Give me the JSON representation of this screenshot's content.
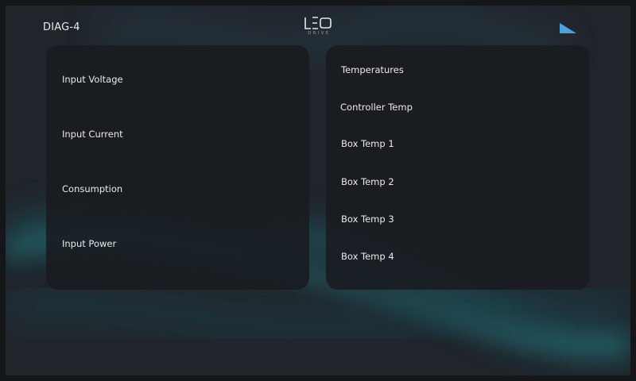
{
  "header": {
    "title": "DIAG-4",
    "logo": {
      "main": "LEO",
      "sub": "DRIVE"
    },
    "status_icon": "signal-strength-icon",
    "accent_color": "#4aa3df"
  },
  "power_panel": {
    "items": [
      {
        "label": "Input Voltage"
      },
      {
        "label": "Input Current"
      },
      {
        "label": "Consumption"
      },
      {
        "label": "Input Power"
      }
    ]
  },
  "temperature_panel": {
    "heading": "Temperatures",
    "items": [
      {
        "label": "Controller Temp"
      },
      {
        "label": "Box Temp 1"
      },
      {
        "label": "Box Temp 2"
      },
      {
        "label": "Box Temp 3"
      },
      {
        "label": "Box Temp 4"
      }
    ]
  }
}
